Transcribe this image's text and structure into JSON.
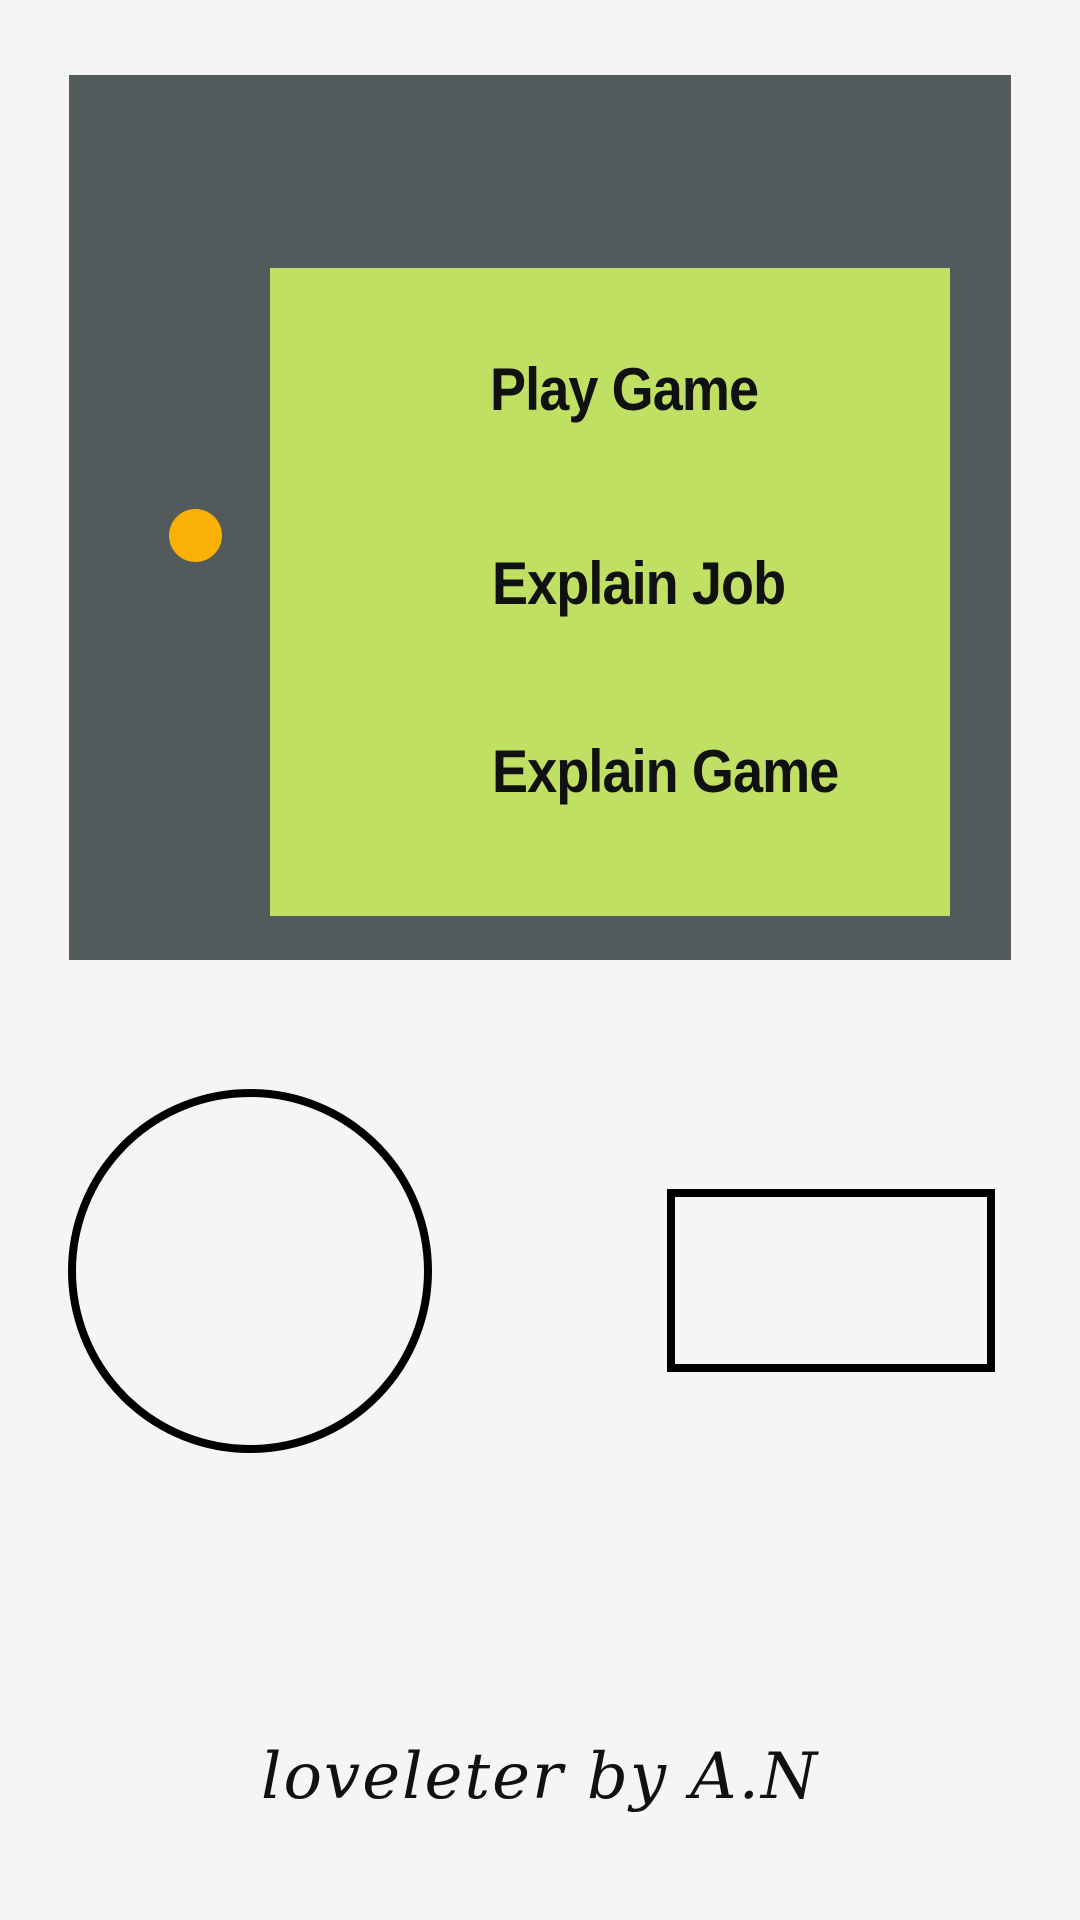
{
  "menu": {
    "items": [
      {
        "label": "Play Game"
      },
      {
        "label": "Explain Job"
      },
      {
        "label": "Explain Game"
      }
    ]
  },
  "footer": {
    "signature": "loveleter by A.N"
  },
  "colors": {
    "console_body": "#525a5b",
    "screen": "#bfe063",
    "power_led": "#fbb005",
    "page_background": "#f5f5f5"
  }
}
